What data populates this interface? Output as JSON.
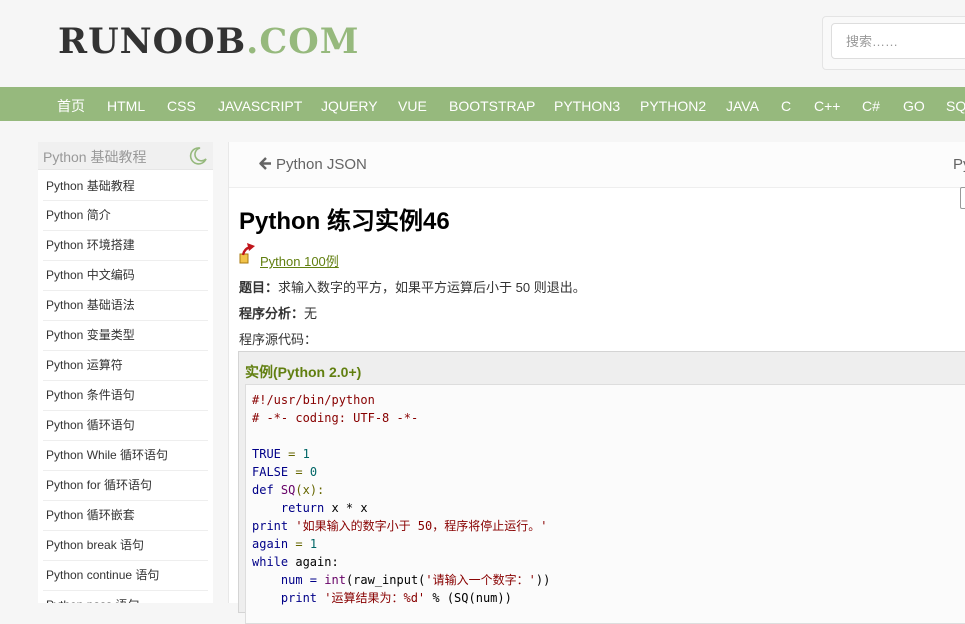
{
  "header": {
    "logo_main": "RUNOOB",
    "logo_suffix": ".COM",
    "search_placeholder": "搜索……"
  },
  "nav": [
    "首页",
    "HTML",
    "CSS",
    "JAVASCRIPT",
    "JQUERY",
    "VUE",
    "BOOTSTRAP",
    "PYTHON3",
    "PYTHON2",
    "JAVA",
    "C",
    "C++",
    "C#",
    "GO",
    "SQL"
  ],
  "sidebar": {
    "title": "Python 基础教程",
    "items": [
      "Python 基础教程",
      "Python 简介",
      "Python 环境搭建",
      "Python 中文编码",
      "Python 基础语法",
      "Python 变量类型",
      "Python 运算符",
      "Python 条件语句",
      "Python 循环语句",
      "Python While 循环语句",
      "Python for 循环语句",
      "Python 循环嵌套",
      "Python break 语句",
      "Python continue 语句",
      "Python pass 语句"
    ]
  },
  "content": {
    "prev_label": "Python JSON",
    "next_label": "Py",
    "title": "Python 练习实例46",
    "back_label": "Python 100例",
    "question_label": "题目：",
    "question_text": "求输入数字的平方，如果平方运算后小于 50 则退出。",
    "analysis_label": "程序分析：",
    "analysis_text": "无",
    "source_label": "程序源代码：",
    "example_title": "实例(Python 2.0+)"
  },
  "code": {
    "l1": "#!/usr/bin/python",
    "l2": "# -*- coding: UTF-8 -*-",
    "l4_id": "TRUE",
    "l4_op": " = ",
    "l4_num": "1",
    "l5_id": "FALSE",
    "l5_op": " = ",
    "l5_num": "0",
    "l6_kw": "def",
    "l6_fn": " SQ",
    "l6_rest": "(x):",
    "l7_kw": "    return",
    "l7_rest": " x * x",
    "l8_kw": "print",
    "l8_str": " '如果输入的数字小于 50，程序将停止运行。'",
    "l9_id": "again",
    "l9_op": " = ",
    "l9_num": "1",
    "l10_kw": "while",
    "l10_rest": " again:",
    "l11_a": "    num = ",
    "l11_fn": "int",
    "l11_b": "(raw_input(",
    "l11_str": "'请输入一个数字：'",
    "l11_c": "))",
    "l12_kw": "    print",
    "l12_str": " '运算结果为：%d'",
    "l12_rest": " % (SQ(num))"
  }
}
